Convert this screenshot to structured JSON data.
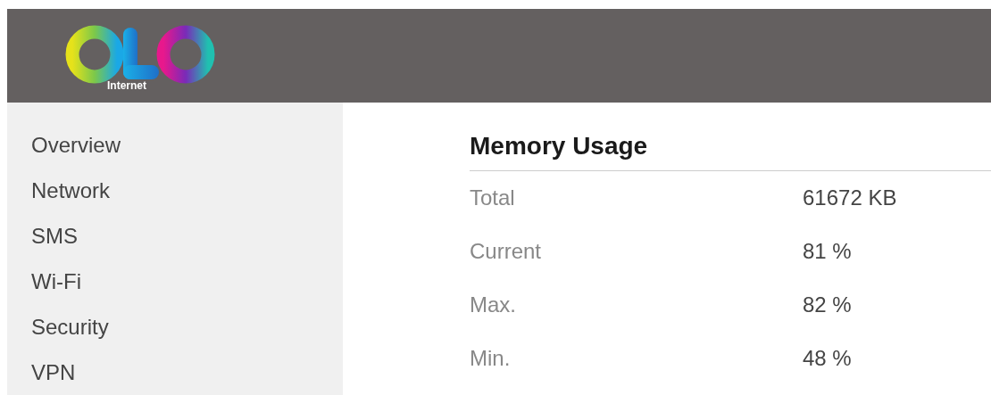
{
  "header": {
    "logo_caption": "Internet"
  },
  "sidebar": {
    "items": [
      {
        "label": "Overview"
      },
      {
        "label": "Network"
      },
      {
        "label": "SMS"
      },
      {
        "label": "Wi-Fi"
      },
      {
        "label": "Security"
      },
      {
        "label": "VPN"
      }
    ]
  },
  "panel": {
    "title": "Memory Usage",
    "rows": [
      {
        "label": "Total",
        "value": "61672 KB"
      },
      {
        "label": "Current",
        "value": "81 %"
      },
      {
        "label": "Max.",
        "value": "82 %"
      },
      {
        "label": "Min.",
        "value": "48 %"
      }
    ]
  }
}
